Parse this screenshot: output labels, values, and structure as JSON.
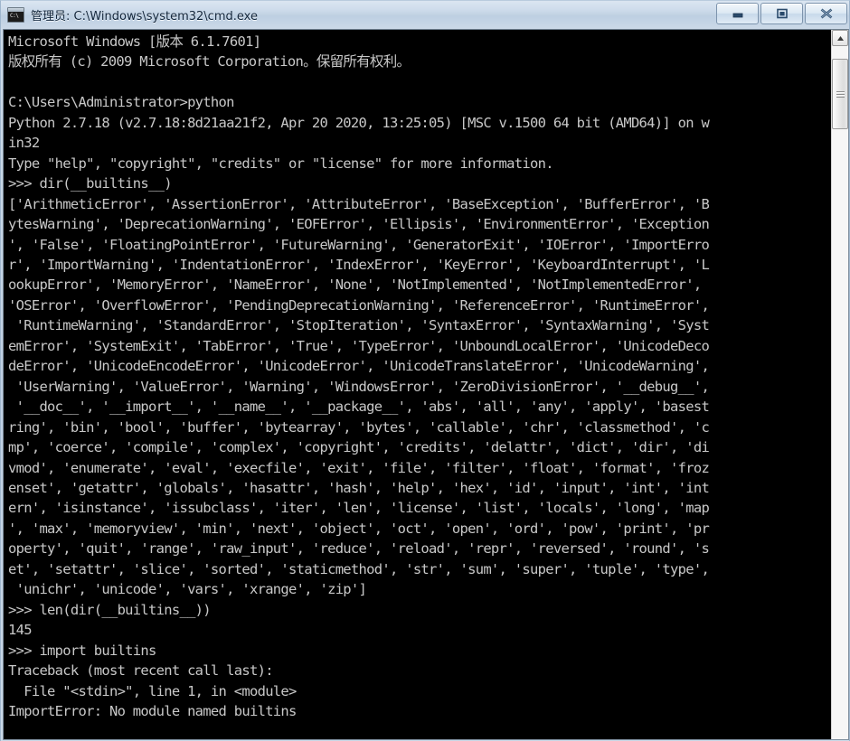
{
  "window": {
    "title": "管理员: C:\\Windows\\system32\\cmd.exe",
    "icon_name": "cmd-icon",
    "icon_glyph": "C:\\",
    "buttons": {
      "minimize_label": "最小化",
      "maximize_label": "最大化",
      "close_label": "关闭"
    }
  },
  "colors": {
    "console_background": "#000000",
    "console_foreground": "#c8c8c8",
    "titlebar_text": "#10243a"
  },
  "scrollbar": {
    "up_arrow_name": "scroll-up-arrow",
    "thumb_name": "scroll-thumb"
  },
  "console": {
    "prompt_symbol": ">>>",
    "shell_prompt": "C:\\Users\\Administrator>",
    "banner": [
      "Microsoft Windows [版本 6.1.7601]",
      "版权所有 (c) 2009 Microsoft Corporation。保留所有权利。"
    ],
    "commands": [
      "python",
      "dir(__builtins__)",
      "len(dir(__builtins__))",
      "import builtins"
    ],
    "python_version": "Python 2.7.18 (v2.7.18:8d21aa21f2, Apr 20 2020, 13:25:05) [MSC v.1500 64 bit (AMD64)] on win32",
    "python_help_hint": "Type \"help\", \"copyright\", \"credits\" or \"license\" for more information.",
    "builtins_count": "145",
    "traceback": [
      "Traceback (most recent call last):",
      "  File \"<stdin>\", line 1, in <module>",
      "ImportError: No module named builtins"
    ],
    "builtins_list": [
      "ArithmeticError",
      "AssertionError",
      "AttributeError",
      "BaseException",
      "BufferError",
      "BytesWarning",
      "DeprecationWarning",
      "EOFError",
      "Ellipsis",
      "EnvironmentError",
      "Exception",
      "False",
      "FloatingPointError",
      "FutureWarning",
      "GeneratorExit",
      "IOError",
      "ImportError",
      "ImportWarning",
      "IndentationError",
      "IndexError",
      "KeyError",
      "KeyboardInterrupt",
      "LookupError",
      "MemoryError",
      "NameError",
      "None",
      "NotImplemented",
      "NotImplementedError",
      "OSError",
      "OverflowError",
      "PendingDeprecationWarning",
      "ReferenceError",
      "RuntimeError",
      "RuntimeWarning",
      "StandardError",
      "StopIteration",
      "SyntaxError",
      "SyntaxWarning",
      "SystemError",
      "SystemExit",
      "TabError",
      "True",
      "TypeError",
      "UnboundLocalError",
      "UnicodeDecodeError",
      "UnicodeEncodeError",
      "UnicodeError",
      "UnicodeTranslateError",
      "UnicodeWarning",
      "UserWarning",
      "ValueError",
      "Warning",
      "WindowsError",
      "ZeroDivisionError",
      "__debug__",
      "__doc__",
      "__import__",
      "__name__",
      "__package__",
      "abs",
      "all",
      "any",
      "apply",
      "basestring",
      "bin",
      "bool",
      "buffer",
      "bytearray",
      "bytes",
      "callable",
      "chr",
      "classmethod",
      "cmp",
      "coerce",
      "compile",
      "complex",
      "copyright",
      "credits",
      "delattr",
      "dict",
      "dir",
      "divmod",
      "enumerate",
      "eval",
      "execfile",
      "exit",
      "file",
      "filter",
      "float",
      "format",
      "frozenset",
      "getattr",
      "globals",
      "hasattr",
      "hash",
      "help",
      "hex",
      "id",
      "input",
      "int",
      "intern",
      "isinstance",
      "issubclass",
      "iter",
      "len",
      "license",
      "list",
      "locals",
      "long",
      "map",
      "max",
      "memoryview",
      "min",
      "next",
      "object",
      "oct",
      "open",
      "ord",
      "pow",
      "print",
      "property",
      "quit",
      "range",
      "raw_input",
      "reduce",
      "reload",
      "repr",
      "reversed",
      "round",
      "set",
      "setattr",
      "slice",
      "sorted",
      "staticmethod",
      "str",
      "sum",
      "super",
      "tuple",
      "type",
      "unichr",
      "unicode",
      "vars",
      "xrange",
      "zip"
    ],
    "screen_lines": [
      "Microsoft Windows [版本 6.1.7601]",
      "版权所有 (c) 2009 Microsoft Corporation。保留所有权利。",
      "",
      "C:\\Users\\Administrator>python",
      "Python 2.7.18 (v2.7.18:8d21aa21f2, Apr 20 2020, 13:25:05) [MSC v.1500 64 bit (AMD64)] on w",
      "in32",
      "Type \"help\", \"copyright\", \"credits\" or \"license\" for more information.",
      ">>> dir(__builtins__)",
      "['ArithmeticError', 'AssertionError', 'AttributeError', 'BaseException', 'BufferError', 'B",
      "ytesWarning', 'DeprecationWarning', 'EOFError', 'Ellipsis', 'EnvironmentError', 'Exception",
      "', 'False', 'FloatingPointError', 'FutureWarning', 'GeneratorExit', 'IOError', 'ImportErro",
      "r', 'ImportWarning', 'IndentationError', 'IndexError', 'KeyError', 'KeyboardInterrupt', 'L",
      "ookupError', 'MemoryError', 'NameError', 'None', 'NotImplemented', 'NotImplementedError',",
      "'OSError', 'OverflowError', 'PendingDeprecationWarning', 'ReferenceError', 'RuntimeError',",
      " 'RuntimeWarning', 'StandardError', 'StopIteration', 'SyntaxError', 'SyntaxWarning', 'Syst",
      "emError', 'SystemExit', 'TabError', 'True', 'TypeError', 'UnboundLocalError', 'UnicodeDeco",
      "deError', 'UnicodeEncodeError', 'UnicodeError', 'UnicodeTranslateError', 'UnicodeWarning',",
      " 'UserWarning', 'ValueError', 'Warning', 'WindowsError', 'ZeroDivisionError', '__debug__',",
      " '__doc__', '__import__', '__name__', '__package__', 'abs', 'all', 'any', 'apply', 'basest",
      "ring', 'bin', 'bool', 'buffer', 'bytearray', 'bytes', 'callable', 'chr', 'classmethod', 'c",
      "mp', 'coerce', 'compile', 'complex', 'copyright', 'credits', 'delattr', 'dict', 'dir', 'di",
      "vmod', 'enumerate', 'eval', 'execfile', 'exit', 'file', 'filter', 'float', 'format', 'froz",
      "enset', 'getattr', 'globals', 'hasattr', 'hash', 'help', 'hex', 'id', 'input', 'int', 'int",
      "ern', 'isinstance', 'issubclass', 'iter', 'len', 'license', 'list', 'locals', 'long', 'map",
      "', 'max', 'memoryview', 'min', 'next', 'object', 'oct', 'open', 'ord', 'pow', 'print', 'pr",
      "operty', 'quit', 'range', 'raw_input', 'reduce', 'reload', 'repr', 'reversed', 'round', 's",
      "et', 'setattr', 'slice', 'sorted', 'staticmethod', 'str', 'sum', 'super', 'tuple', 'type',",
      " 'unichr', 'unicode', 'vars', 'xrange', 'zip']",
      ">>> len(dir(__builtins__))",
      "145",
      ">>> import builtins",
      "Traceback (most recent call last):",
      "  File \"<stdin>\", line 1, in <module>",
      "ImportError: No module named builtins"
    ]
  }
}
